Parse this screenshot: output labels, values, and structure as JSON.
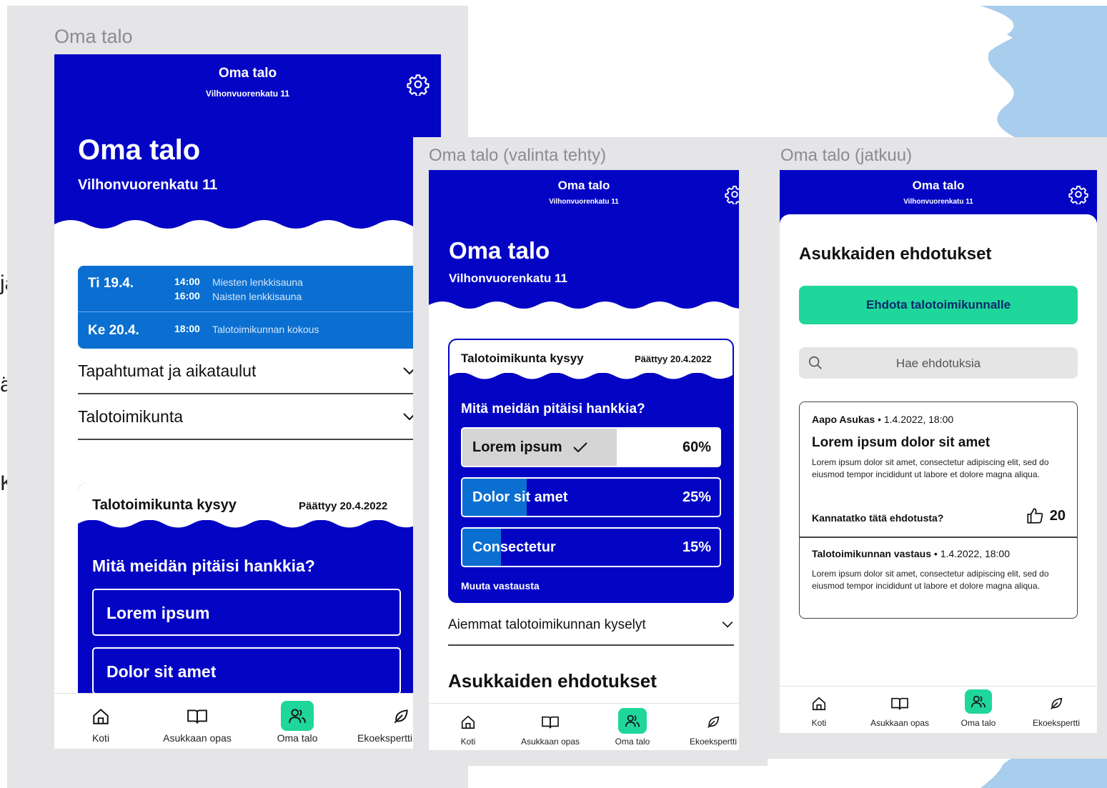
{
  "colors": {
    "brand_blue": "#0404c4",
    "schedule_blue": "#0a6fd1",
    "accent_green": "#1fd69b",
    "frame_gray": "#e5e4e6",
    "decor_light_blue": "#a9cdec"
  },
  "edge_letters": [
    "ja",
    "ä",
    "K"
  ],
  "frame1": {
    "label": "Oma talo",
    "header": {
      "title": "Oma talo",
      "subtitle": "Vilhonvuorenkatu 11",
      "settings_icon": "gear-icon"
    },
    "hero": {
      "title": "Oma talo",
      "address": "Vilhonvuorenkatu 11"
    },
    "schedule": [
      {
        "day": "Ti 19.4.",
        "events": [
          {
            "time": "14:00",
            "name": "Miesten lenkkisauna"
          },
          {
            "time": "16:00",
            "name": "Naisten lenkkisauna"
          }
        ]
      },
      {
        "day": "Ke 20.4.",
        "events": [
          {
            "time": "18:00",
            "name": "Talotoimikunnan kokous"
          }
        ]
      }
    ],
    "accordions": [
      "Tapahtumat ja aikataulut",
      "Talotoimikunta"
    ],
    "poll": {
      "title": "Talotoimikunta kysyy",
      "ends": "Päättyy 20.4.2022",
      "question": "Mitä meidän pitäisi hankkia?",
      "options": [
        "Lorem ipsum",
        "Dolor sit amet"
      ]
    },
    "nav": [
      {
        "label": "Koti",
        "icon": "home-icon",
        "active": false
      },
      {
        "label": "Asukkaan opas",
        "icon": "book-icon",
        "active": false
      },
      {
        "label": "Oma talo",
        "icon": "people-icon",
        "active": true
      },
      {
        "label": "Ekoekspertti",
        "icon": "leaf-icon",
        "active": false
      }
    ]
  },
  "frame2": {
    "label": "Oma talo (valinta tehty)",
    "header": {
      "title": "Oma talo",
      "subtitle": "Vilhonvuorenkatu 11",
      "settings_icon": "gear-icon"
    },
    "hero": {
      "title": "Oma talo",
      "address": "Vilhonvuorenkatu 11"
    },
    "poll": {
      "title": "Talotoimikunta kysyy",
      "ends": "Päättyy 20.4.2022",
      "question": "Mitä meidän pitäisi hankkia?",
      "results": [
        {
          "label": "Lorem ipsum",
          "percent_label": "60%",
          "percent": 60,
          "selected": true
        },
        {
          "label": "Dolor sit amet",
          "percent_label": "25%",
          "percent": 25,
          "selected": false
        },
        {
          "label": "Consectetur",
          "percent_label": "15%",
          "percent": 15,
          "selected": false
        }
      ],
      "change_answer": "Muuta vastausta"
    },
    "accordion": "Aiemmat talotoimikunnan kyselyt",
    "section_title": "Asukkaiden ehdotukset",
    "nav": [
      {
        "label": "Koti",
        "icon": "home-icon",
        "active": false
      },
      {
        "label": "Asukkaan opas",
        "icon": "book-icon",
        "active": false
      },
      {
        "label": "Oma talo",
        "icon": "people-icon",
        "active": true
      },
      {
        "label": "Ekoekspertti",
        "icon": "leaf-icon",
        "active": false
      }
    ]
  },
  "frame3": {
    "label": "Oma talo (jatkuu)",
    "header": {
      "title": "Oma talo",
      "subtitle": "Vilhonvuorenkatu 11",
      "settings_icon": "gear-icon"
    },
    "section_title": "Asukkaiden ehdotukset",
    "cta": "Ehdota talotoimikunnalle",
    "search_placeholder": "Hae ehdotuksia",
    "proposal": {
      "author": "Aapo Asukas",
      "date": "1.4.2022, 18:00",
      "title": "Lorem ipsum dolor sit amet",
      "body": "Lorem ipsum dolor sit amet, consectetur adipiscing elit, sed do eiusmod tempor incididunt ut labore et dolore magna aliqua.",
      "support_question": "Kannatatko tätä ehdotusta?",
      "likes": "20",
      "reply_author": "Talotoimikunnan vastaus",
      "reply_date": "1.4.2022, 18:00",
      "reply_body": "Lorem ipsum dolor sit amet, consectetur adipiscing elit, sed do eiusmod tempor incididunt ut labore et dolore magna aliqua."
    },
    "nav": [
      {
        "label": "Koti",
        "icon": "home-icon",
        "active": false
      },
      {
        "label": "Asukkaan opas",
        "icon": "book-icon",
        "active": false
      },
      {
        "label": "Oma talo",
        "icon": "people-icon",
        "active": true
      },
      {
        "label": "Ekoekspertti",
        "icon": "leaf-icon",
        "active": false
      }
    ]
  }
}
